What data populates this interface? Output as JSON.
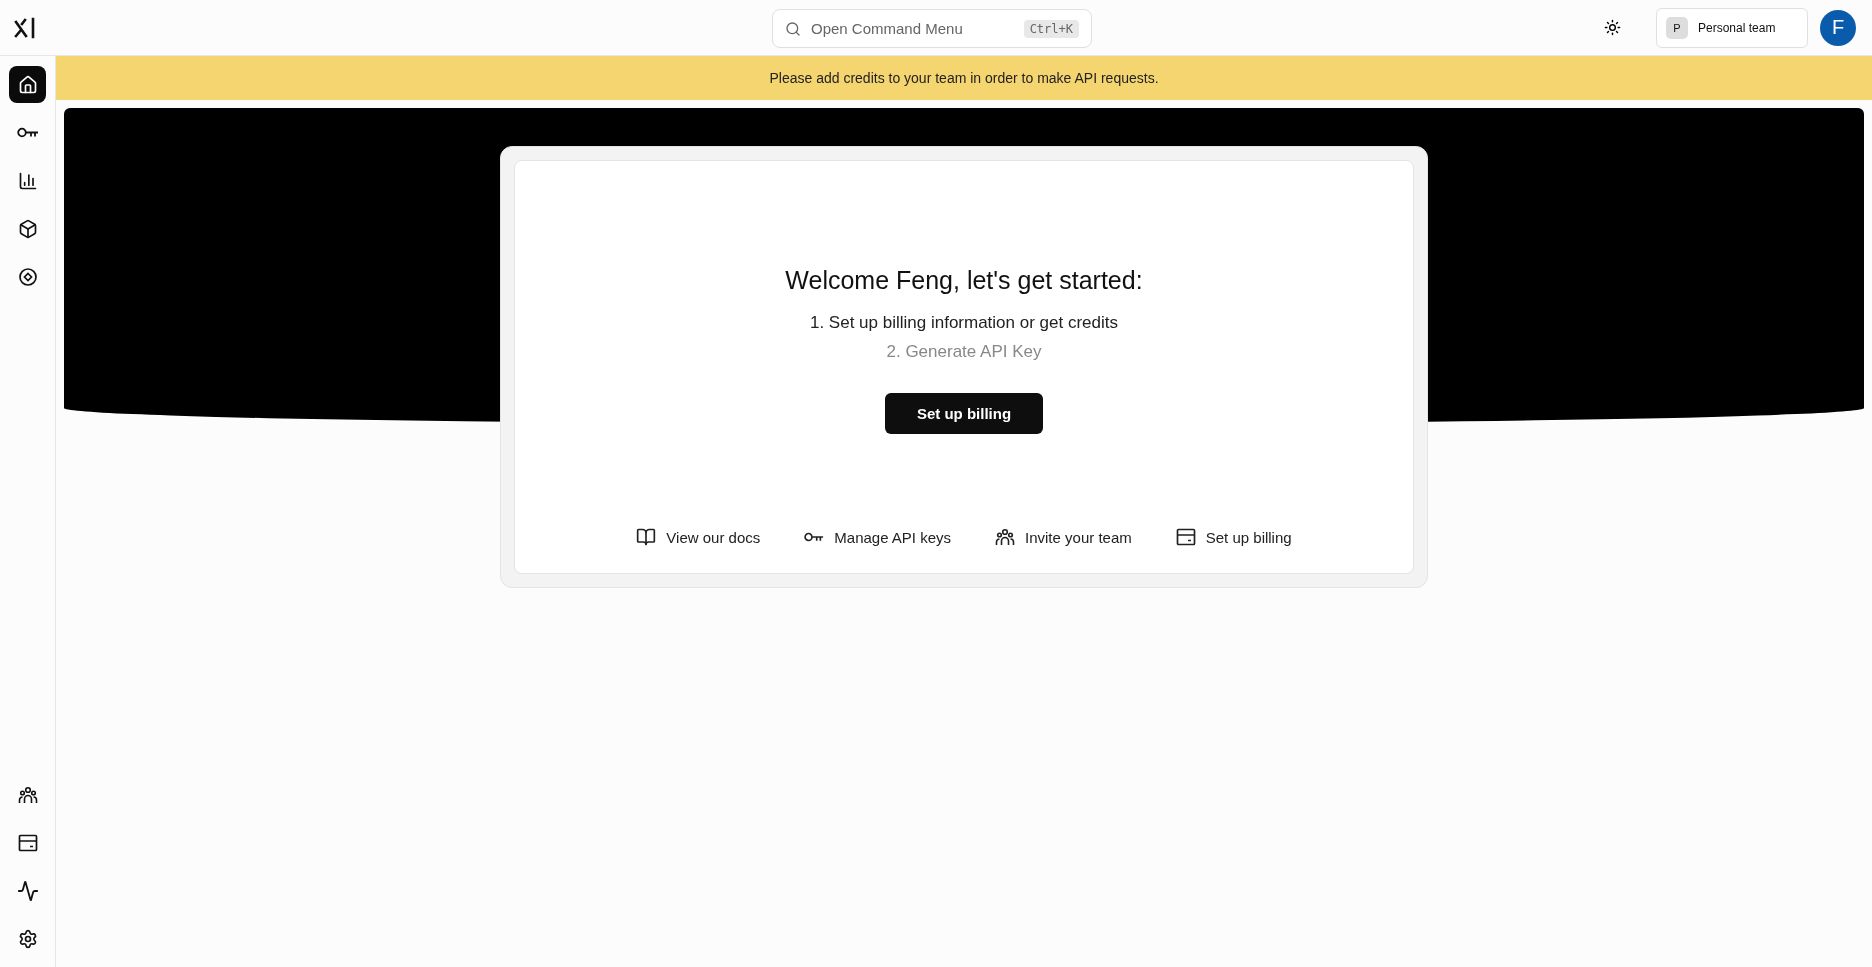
{
  "topbar": {
    "search": {
      "placeholder": "Open Command Menu",
      "shortcut": "Ctrl+K"
    },
    "team": {
      "initial": "P",
      "name": "Personal team"
    },
    "avatar": "F"
  },
  "sidebar": {
    "top_items": [
      {
        "kind": "home",
        "selected": true
      },
      {
        "kind": "key",
        "selected": false
      },
      {
        "kind": "chart",
        "selected": false
      },
      {
        "kind": "cube",
        "selected": false
      },
      {
        "kind": "target",
        "selected": false
      }
    ],
    "bottom_items": [
      {
        "kind": "team",
        "selected": false
      },
      {
        "kind": "billing",
        "selected": false
      },
      {
        "kind": "activity",
        "selected": false
      },
      {
        "kind": "settings",
        "selected": false
      }
    ]
  },
  "banner": "Please add credits to your team in order to make API requests.",
  "welcome": {
    "title": "Welcome Feng, let's get started:",
    "steps": [
      {
        "text": "1. Set up billing information or get credits",
        "active": true
      },
      {
        "text": "2. Generate API Key",
        "active": false
      }
    ],
    "button": "Set up billing",
    "links": [
      {
        "kind": "docs",
        "label": "View our docs"
      },
      {
        "kind": "key",
        "label": "Manage API keys"
      },
      {
        "kind": "team",
        "label": "Invite your team"
      },
      {
        "kind": "billing",
        "label": "Set up billing"
      }
    ]
  }
}
